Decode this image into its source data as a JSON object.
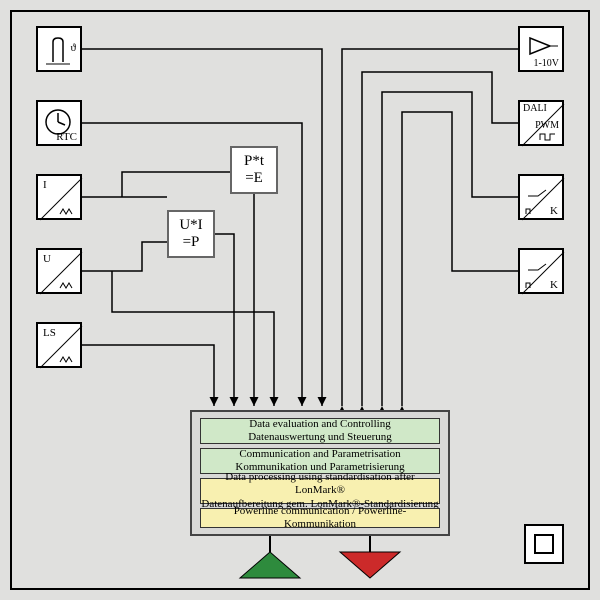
{
  "sensors": {
    "temp": {
      "label": "ϑ"
    },
    "rtc": {
      "label": "RTC"
    },
    "current": {
      "label": "I"
    },
    "voltage": {
      "label": "U"
    },
    "ls": {
      "label": "LS"
    }
  },
  "outputs": {
    "analog": {
      "label": "1-10V"
    },
    "dali": {
      "top": "DALI",
      "bottom": "PWM"
    },
    "relay1": {
      "label": "K"
    },
    "relay2": {
      "label": "K"
    }
  },
  "proc": {
    "power": {
      "l1": "U*I",
      "l2": "=P"
    },
    "energy": {
      "l1": "P*t",
      "l2": "=E"
    }
  },
  "layers": {
    "eval": {
      "en": "Data evaluation and Controlling",
      "de": "Datenauswertung und Steuerung"
    },
    "comm": {
      "en": "Communication and Parametrisation",
      "de": "Kommunikation und Parametrisierung"
    },
    "std": {
      "en": "Data processing using standardisation after LonMark®",
      "de": "Datenaufbereitung gem. LonMark®-Standardisierung"
    },
    "plc": {
      "en": "Powerline communication / Powerline-Kommunikation"
    }
  }
}
